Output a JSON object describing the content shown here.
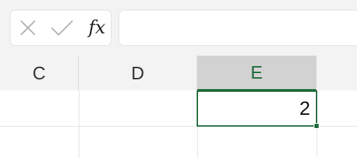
{
  "formula_bar": {
    "cancel_icon": "close-icon",
    "enter_icon": "check-icon",
    "function_label": "fx",
    "formula_value": ""
  },
  "columns": [
    "C",
    "D",
    "E"
  ],
  "active_column": "E",
  "cells": {
    "E_active": "2"
  },
  "colors": {
    "accent": "#1e6b3a",
    "header_bg": "#f3f3f3",
    "active_header_bg": "#d2d2d2"
  }
}
